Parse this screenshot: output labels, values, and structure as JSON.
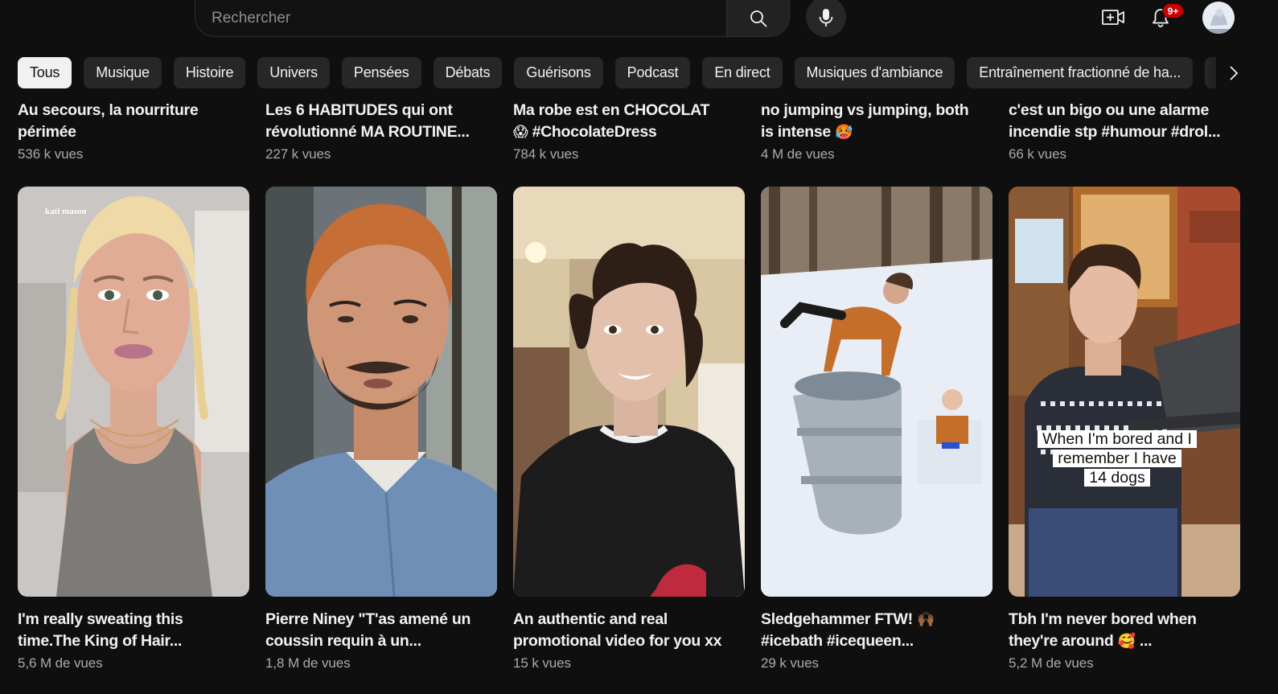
{
  "header": {
    "search_placeholder": "Rechercher",
    "notifications_badge": "9+"
  },
  "chips": [
    "Tous",
    "Musique",
    "Histoire",
    "Univers",
    "Pensées",
    "Débats",
    "Guérisons",
    "Podcast",
    "En direct",
    "Musiques d'ambiance",
    "Entraînement fractionné de ha..."
  ],
  "row1": [
    {
      "title_l1": "Au secours, la nourriture",
      "title_l2": "périmée",
      "views": "536 k vues"
    },
    {
      "title_l1": "Les 6 HABITUDES qui ont",
      "title_l2": "révolutionné MA ROUTINE...",
      "views": "227 k vues"
    },
    {
      "title_l1": "Ma robe est en CHOCOLAT",
      "title_l2": "#ChocolateDress",
      "title_emoji": "😱",
      "views": "784 k vues"
    },
    {
      "title_l1": "no jumping vs jumping, both",
      "title_l2": "is intense",
      "title_emoji": "🥵",
      "views": "4 M de vues"
    },
    {
      "title_l1": "c'est un bigo ou une alarme",
      "title_l2": "incendie stp #humour #drol...",
      "views": "66 k vues"
    }
  ],
  "row2": [
    {
      "title_l1": "I'm really sweating this",
      "title_l2": "time.The King of Hair...",
      "views": "5,6 M de vues",
      "watermark": "kati mason"
    },
    {
      "title_l1": "Pierre Niney \"T'as amené un",
      "title_l2": "coussin requin à un...",
      "views": "1,8 M de vues"
    },
    {
      "title_l1": "An authentic and real",
      "title_l2": "promotional video for you xx",
      "views": "15 k vues"
    },
    {
      "title_l1": "Sledgehammer FTW!",
      "title_l2": "#icebath #icequeen...",
      "title_emoji": "🙌🏾",
      "views": "29 k vues"
    },
    {
      "title_l1": "Tbh I'm never bored when",
      "title_l2": "they're around",
      "title_emoji": "🥰",
      "title_tail": "...",
      "views": "5,2 M de vues",
      "caption_l1": "When I'm bored and I",
      "caption_l2": "remember I have",
      "caption_l3": "14 dogs"
    }
  ],
  "colors": {
    "background": "#0f0f0f",
    "chip": "#272727",
    "chip_active": "#f1f1f1",
    "secondary_text": "#aaaaaa",
    "badge": "#cc0000"
  }
}
